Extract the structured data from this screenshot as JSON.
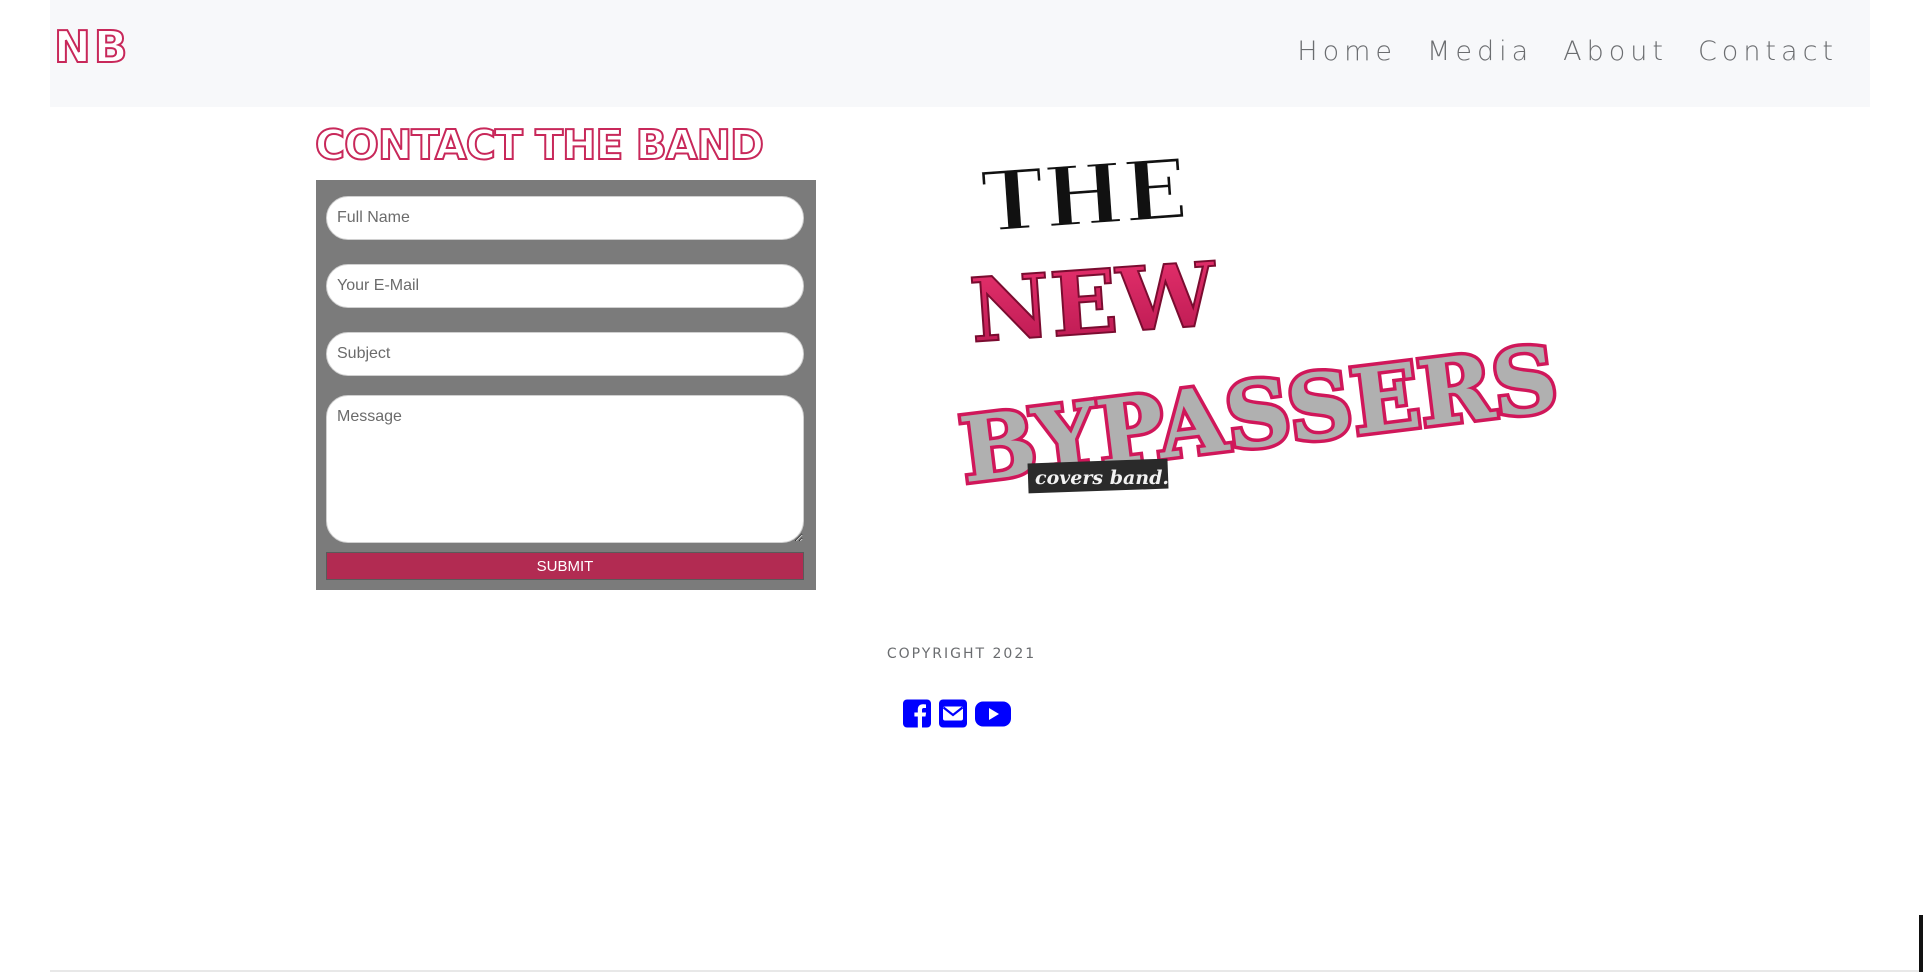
{
  "nav": {
    "brand": "NB",
    "links": [
      "Home",
      "Media",
      "About",
      "Contact"
    ]
  },
  "contact": {
    "title": "Contact the band",
    "fields": {
      "name_placeholder": "Full Name",
      "email_placeholder": "Your E-Mail",
      "subject_placeholder": "Subject",
      "message_placeholder": "Message"
    },
    "submit_label": "SUBMIT"
  },
  "logo": {
    "line1": "THE",
    "line2": "NEW",
    "line3": "BYPASSERS",
    "tagline": "covers band."
  },
  "footer": {
    "copyright": "COPYRIGHT 2021",
    "social_icons": [
      "facebook-icon",
      "envelope-icon",
      "youtube-icon"
    ]
  },
  "colors": {
    "accent": "#c8285a",
    "submit": "#b22b52",
    "panel": "#7b7b7b",
    "icons": "#0000ff",
    "navbar": "#f7f8fa"
  }
}
